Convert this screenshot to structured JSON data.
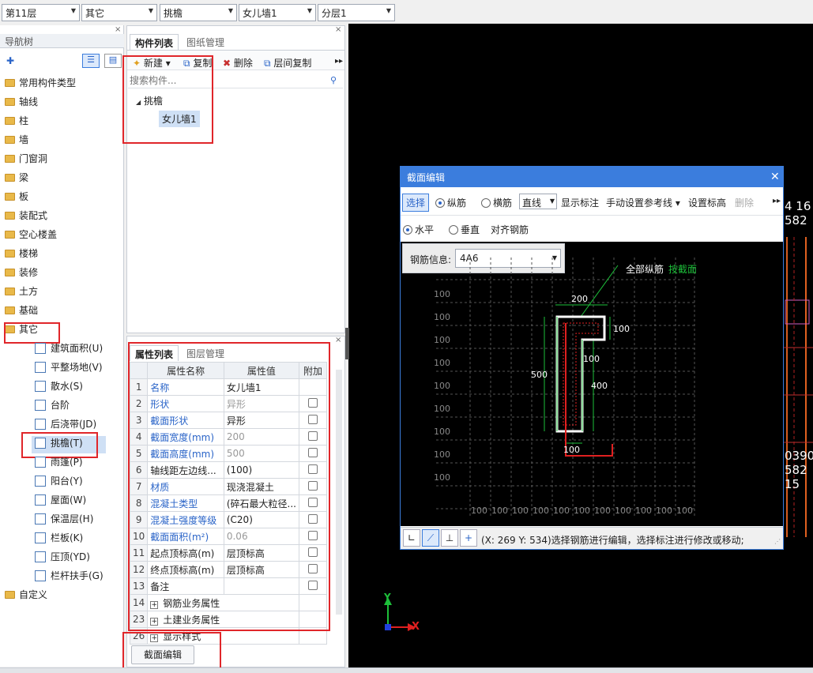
{
  "toolbar": {
    "floor": "第11层",
    "category": "其它",
    "component_type": "挑檐",
    "component": "女儿墙1",
    "layer": "分层1"
  },
  "nav": {
    "title": "导航树",
    "folders": [
      "常用构件类型",
      "轴线",
      "柱",
      "墙",
      "门窗洞",
      "梁",
      "板",
      "装配式",
      "空心楼盖",
      "楼梯",
      "装修",
      "土方",
      "基础",
      "其它"
    ],
    "sub_items": [
      "建筑面积(U)",
      "平整场地(V)",
      "散水(S)",
      "台阶",
      "后浇带(JD)",
      "挑檐(T)",
      "雨篷(P)",
      "阳台(Y)",
      "屋面(W)",
      "保温层(H)",
      "栏板(K)",
      "压顶(YD)",
      "栏杆扶手(G)"
    ],
    "last_folder": "自定义"
  },
  "component_panel": {
    "tab_active": "构件列表",
    "tab_inactive": "图纸管理",
    "new_label": "新建",
    "copy_label": "复制",
    "delete_label": "删除",
    "floor_copy_label": "层间复制",
    "search_placeholder": "搜索构件...",
    "group": "挑檐",
    "item": "女儿墙1"
  },
  "property_panel": {
    "tab_active": "属性列表",
    "tab_inactive": "图层管理",
    "col_name": "属性名称",
    "col_value": "属性值",
    "col_extra": "附加",
    "rows": [
      {
        "n": "1",
        "name": "名称",
        "value": "女儿墙1"
      },
      {
        "n": "2",
        "name": "形状",
        "value": "异形"
      },
      {
        "n": "3",
        "name": "截面形状",
        "value": "异形"
      },
      {
        "n": "4",
        "name": "截面宽度(mm)",
        "value": "200"
      },
      {
        "n": "5",
        "name": "截面高度(mm)",
        "value": "500"
      },
      {
        "n": "6",
        "name": "轴线距左边线...",
        "value": "(100)"
      },
      {
        "n": "7",
        "name": "材质",
        "value": "现浇混凝土"
      },
      {
        "n": "8",
        "name": "混凝土类型",
        "value": "(碎石最大粒径..."
      },
      {
        "n": "9",
        "name": "混凝土强度等级",
        "value": "(C20)"
      },
      {
        "n": "10",
        "name": "截面面积(m²)",
        "value": "0.06"
      },
      {
        "n": "11",
        "name": "起点顶标高(m)",
        "value": "层顶标高"
      },
      {
        "n": "12",
        "name": "终点顶标高(m)",
        "value": "层顶标高"
      },
      {
        "n": "13",
        "name": "备注",
        "value": ""
      },
      {
        "n": "14",
        "name": "钢筋业务属性",
        "value": ""
      },
      {
        "n": "23",
        "name": "土建业务属性",
        "value": ""
      },
      {
        "n": "26",
        "name": "显示样式",
        "value": ""
      }
    ],
    "section_button": "截面编辑"
  },
  "dialog": {
    "title": "截面编辑",
    "select_btn": "选择",
    "radio_long": "纵筋",
    "radio_trans": "横筋",
    "line_mode": "直线",
    "show_label": "显示标注",
    "manual_ref": "手动设置参考线",
    "set_elev": "设置标高",
    "delete": "删除",
    "radio_h": "水平",
    "radio_v": "垂直",
    "align": "对齐钢筋",
    "rebar_label": "钢筋信息:",
    "rebar_value": "4A6",
    "all_rebar": "全部纵筋",
    "by_section": "按截面",
    "dims": {
      "top": "200",
      "right": "100",
      "inner": "100",
      "left": "500",
      "vert": "400",
      "bottom": "100"
    },
    "grid_label": "100",
    "status": "(X: 269 Y: 534)选择钢筋进行编辑，选择标注进行修改或移动;"
  },
  "canvas": {
    "right_texts": [
      "4 16",
      "582",
      "0390",
      "582",
      "15"
    ],
    "axis_x": "X",
    "axis_y": "Y"
  }
}
